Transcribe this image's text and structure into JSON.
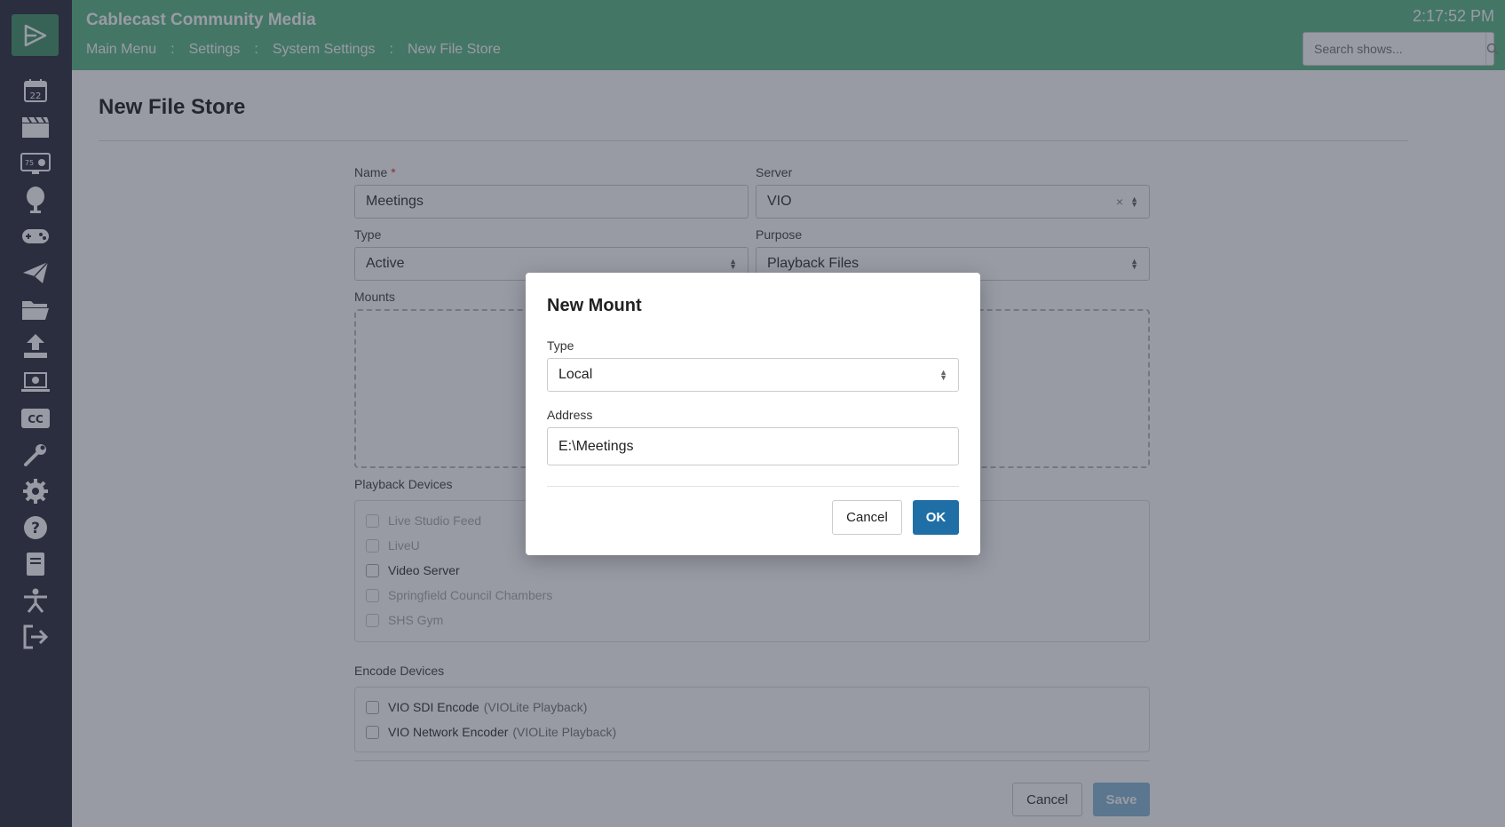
{
  "app": {
    "brand": "Cablecast Community Media",
    "clock": "2:17:52 PM"
  },
  "breadcrumb": {
    "items": [
      "Main Menu",
      "Settings",
      "System Settings",
      "New File Store"
    ],
    "separator": ":"
  },
  "search": {
    "placeholder": "Search shows..."
  },
  "sidebar": {
    "icons": [
      "logo-icon",
      "calendar-icon",
      "clapperboard-icon",
      "monitor-icon",
      "microphone-icon",
      "gamepad-icon",
      "paper-plane-icon",
      "folder-icon",
      "upload-icon",
      "laptop-icon",
      "closed-caption-icon",
      "wrench-icon",
      "gear-icon",
      "help-icon",
      "book-icon",
      "accessibility-icon",
      "logout-icon"
    ],
    "calendar_day": "22",
    "monitor_badge": "75"
  },
  "page": {
    "title": "New File Store"
  },
  "form": {
    "name": {
      "label": "Name",
      "required_mark": "*",
      "value": "Meetings"
    },
    "server": {
      "label": "Server",
      "value": "VIO",
      "clear": "×"
    },
    "type": {
      "label": "Type",
      "value": "Active"
    },
    "purpose": {
      "label": "Purpose",
      "value": "Playback Files"
    },
    "mounts": {
      "label": "Mounts"
    },
    "playback_devices": {
      "label": "Playback Devices",
      "items": [
        "Live Studio Feed",
        "LiveU",
        "Video Server",
        "Springfield Council Chambers",
        "SHS Gym"
      ]
    },
    "encode_devices": {
      "label": "Encode Devices",
      "items": [
        {
          "name": "VIO SDI Encode",
          "detail": "(VIOLite Playback)"
        },
        {
          "name": "VIO Network Encoder",
          "detail": "(VIOLite Playback)"
        }
      ]
    },
    "cancel_label": "Cancel",
    "save_label": "Save"
  },
  "modal": {
    "title": "New Mount",
    "type_label": "Type",
    "type_value": "Local",
    "address_label": "Address",
    "address_value": "E:\\Meetings",
    "cancel_label": "Cancel",
    "ok_label": "OK"
  },
  "colors": {
    "header": "#5eb887",
    "sidebar": "#2f2f3f",
    "primary_button": "#1f6fa6"
  }
}
